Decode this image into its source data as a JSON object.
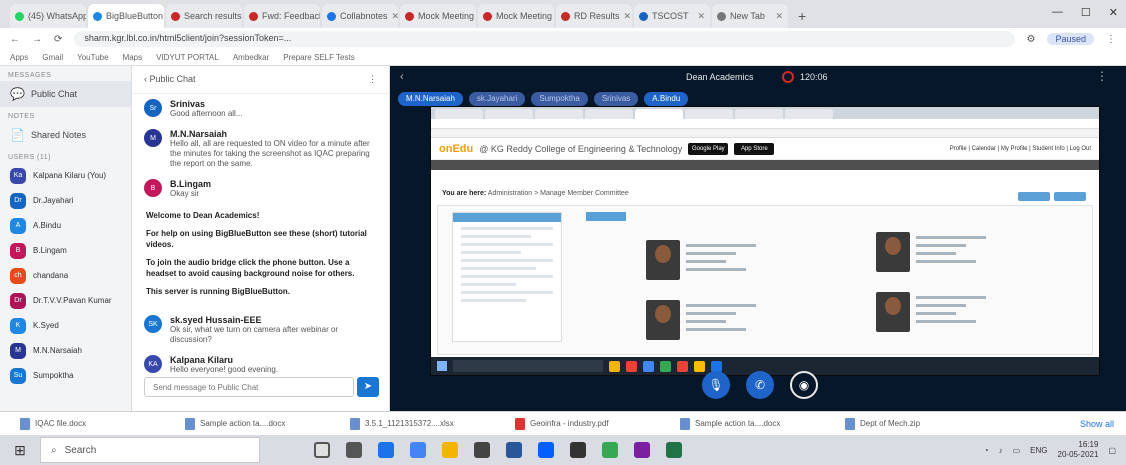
{
  "browser": {
    "tabs": [
      {
        "label": "(45) WhatsApp"
      },
      {
        "label": "BigBlueButton"
      },
      {
        "label": "Search results"
      },
      {
        "label": "Fwd: Feedback"
      },
      {
        "label": "Collabnotes"
      },
      {
        "label": "Mock Meeting"
      },
      {
        "label": "Mock Meeting"
      },
      {
        "label": "RD Results"
      },
      {
        "label": "TSCOST"
      },
      {
        "label": "New Tab"
      }
    ],
    "url": "sharm.kgr.lbl.co.in/html5client/join?sessionToken=...",
    "profile_label": "Paused",
    "bookmarks": [
      "Apps",
      "Gmail",
      "YouTube",
      "Maps",
      "VIDYUT PORTAL",
      "Ambedkar",
      "Prepare SELF Tests"
    ]
  },
  "sidebar": {
    "messages_label": "MESSAGES",
    "public_chat": "Public Chat",
    "notes_label": "NOTES",
    "shared_notes": "Shared Notes",
    "users_label": "USERS (11)",
    "users": [
      {
        "initials": "Ka",
        "name": "Kalpana Kilaru (You)",
        "color": "#3949ab"
      },
      {
        "initials": "Dr",
        "name": "Dr.Jayahari",
        "color": "#1565c0"
      },
      {
        "initials": "A",
        "name": "A.Bindu",
        "color": "#1e88e5"
      },
      {
        "initials": "B",
        "name": "B.Lingam",
        "color": "#c2185b"
      },
      {
        "initials": "ch",
        "name": "chandana",
        "color": "#e64a19"
      },
      {
        "initials": "Dr",
        "name": "Dr.T.V.V.Pavan Kumar",
        "color": "#ad1457"
      },
      {
        "initials": "K",
        "name": "K.Syed",
        "color": "#1e88e5"
      },
      {
        "initials": "M",
        "name": "M.N.Narsaiah",
        "color": "#283593"
      },
      {
        "initials": "Su",
        "name": "Sumpoktha",
        "color": "#1976d2"
      }
    ]
  },
  "chat": {
    "title": "Public Chat",
    "messages": [
      {
        "initials": "Sr",
        "name": "Srinivas",
        "time": "",
        "text": "Good afternoon all...",
        "color": "#1565c0"
      },
      {
        "initials": "M",
        "name": "M.N.Narsaiah",
        "time": "",
        "text": "Hello all, all are requested to ON video for a minute after the minutes for taking the screenshot as IQAC preparing the report on the same.",
        "color": "#283593"
      },
      {
        "initials": "B",
        "name": "B.Lingam",
        "time": "",
        "text": "Okay sir",
        "color": "#c2185b"
      }
    ],
    "welcome_title": "Welcome to Dean Academics!",
    "welcome_lines": [
      "For help on using BigBlueButton see these (short) tutorial videos.",
      "To join the audio bridge click the phone button. Use a headset to avoid causing background noise for others.",
      "This server is running BigBlueButton."
    ],
    "later_messages": [
      {
        "initials": "SK",
        "name": "sk.syed Hussain-EEE",
        "time": "",
        "text": "Ok sir, what we turn on camera after webinar or discussion?",
        "color": "#1976d2"
      },
      {
        "initials": "KA",
        "name": "Kalpana Kilaru",
        "time": "",
        "text": "Hello everyone! good evening.",
        "color": "#3949ab"
      }
    ],
    "input_placeholder": "Send message to Public Chat"
  },
  "meeting": {
    "title": "Dean Academics",
    "recording_time": "120:06",
    "talkers": [
      "M.N.Narsaiah",
      "sk.Jayahari",
      "Sumpoktha",
      "Srinivas",
      "A.Bindu"
    ]
  },
  "shared_screen": {
    "logo": "onEdu",
    "college": "@ KG Reddy College of Engineering & Technology",
    "store1": "Google Play",
    "store2": "App Store",
    "links": "Profile | Calendar | My Profile | Student Info | Log Out",
    "breadcrumb_prefix": "You are here:",
    "breadcrumb": "Administration > Manage Member Committee"
  },
  "downloads": [
    {
      "name": "IQAC file.docx",
      "type": "doc"
    },
    {
      "name": "Sample action ta....docx",
      "type": "doc"
    },
    {
      "name": "3.5.1_1121315372....xlsx",
      "type": "doc"
    },
    {
      "name": "Geoinfra - industry.pdf",
      "type": "pdf"
    },
    {
      "name": "Sample action ta....docx",
      "type": "doc"
    },
    {
      "name": "Dept of Mech.zip",
      "type": "doc"
    }
  ],
  "downloads_show_all": "Show all",
  "taskbar": {
    "search": "Search",
    "lang": "ENG",
    "time": "16:19",
    "date": "20-05-2021"
  }
}
